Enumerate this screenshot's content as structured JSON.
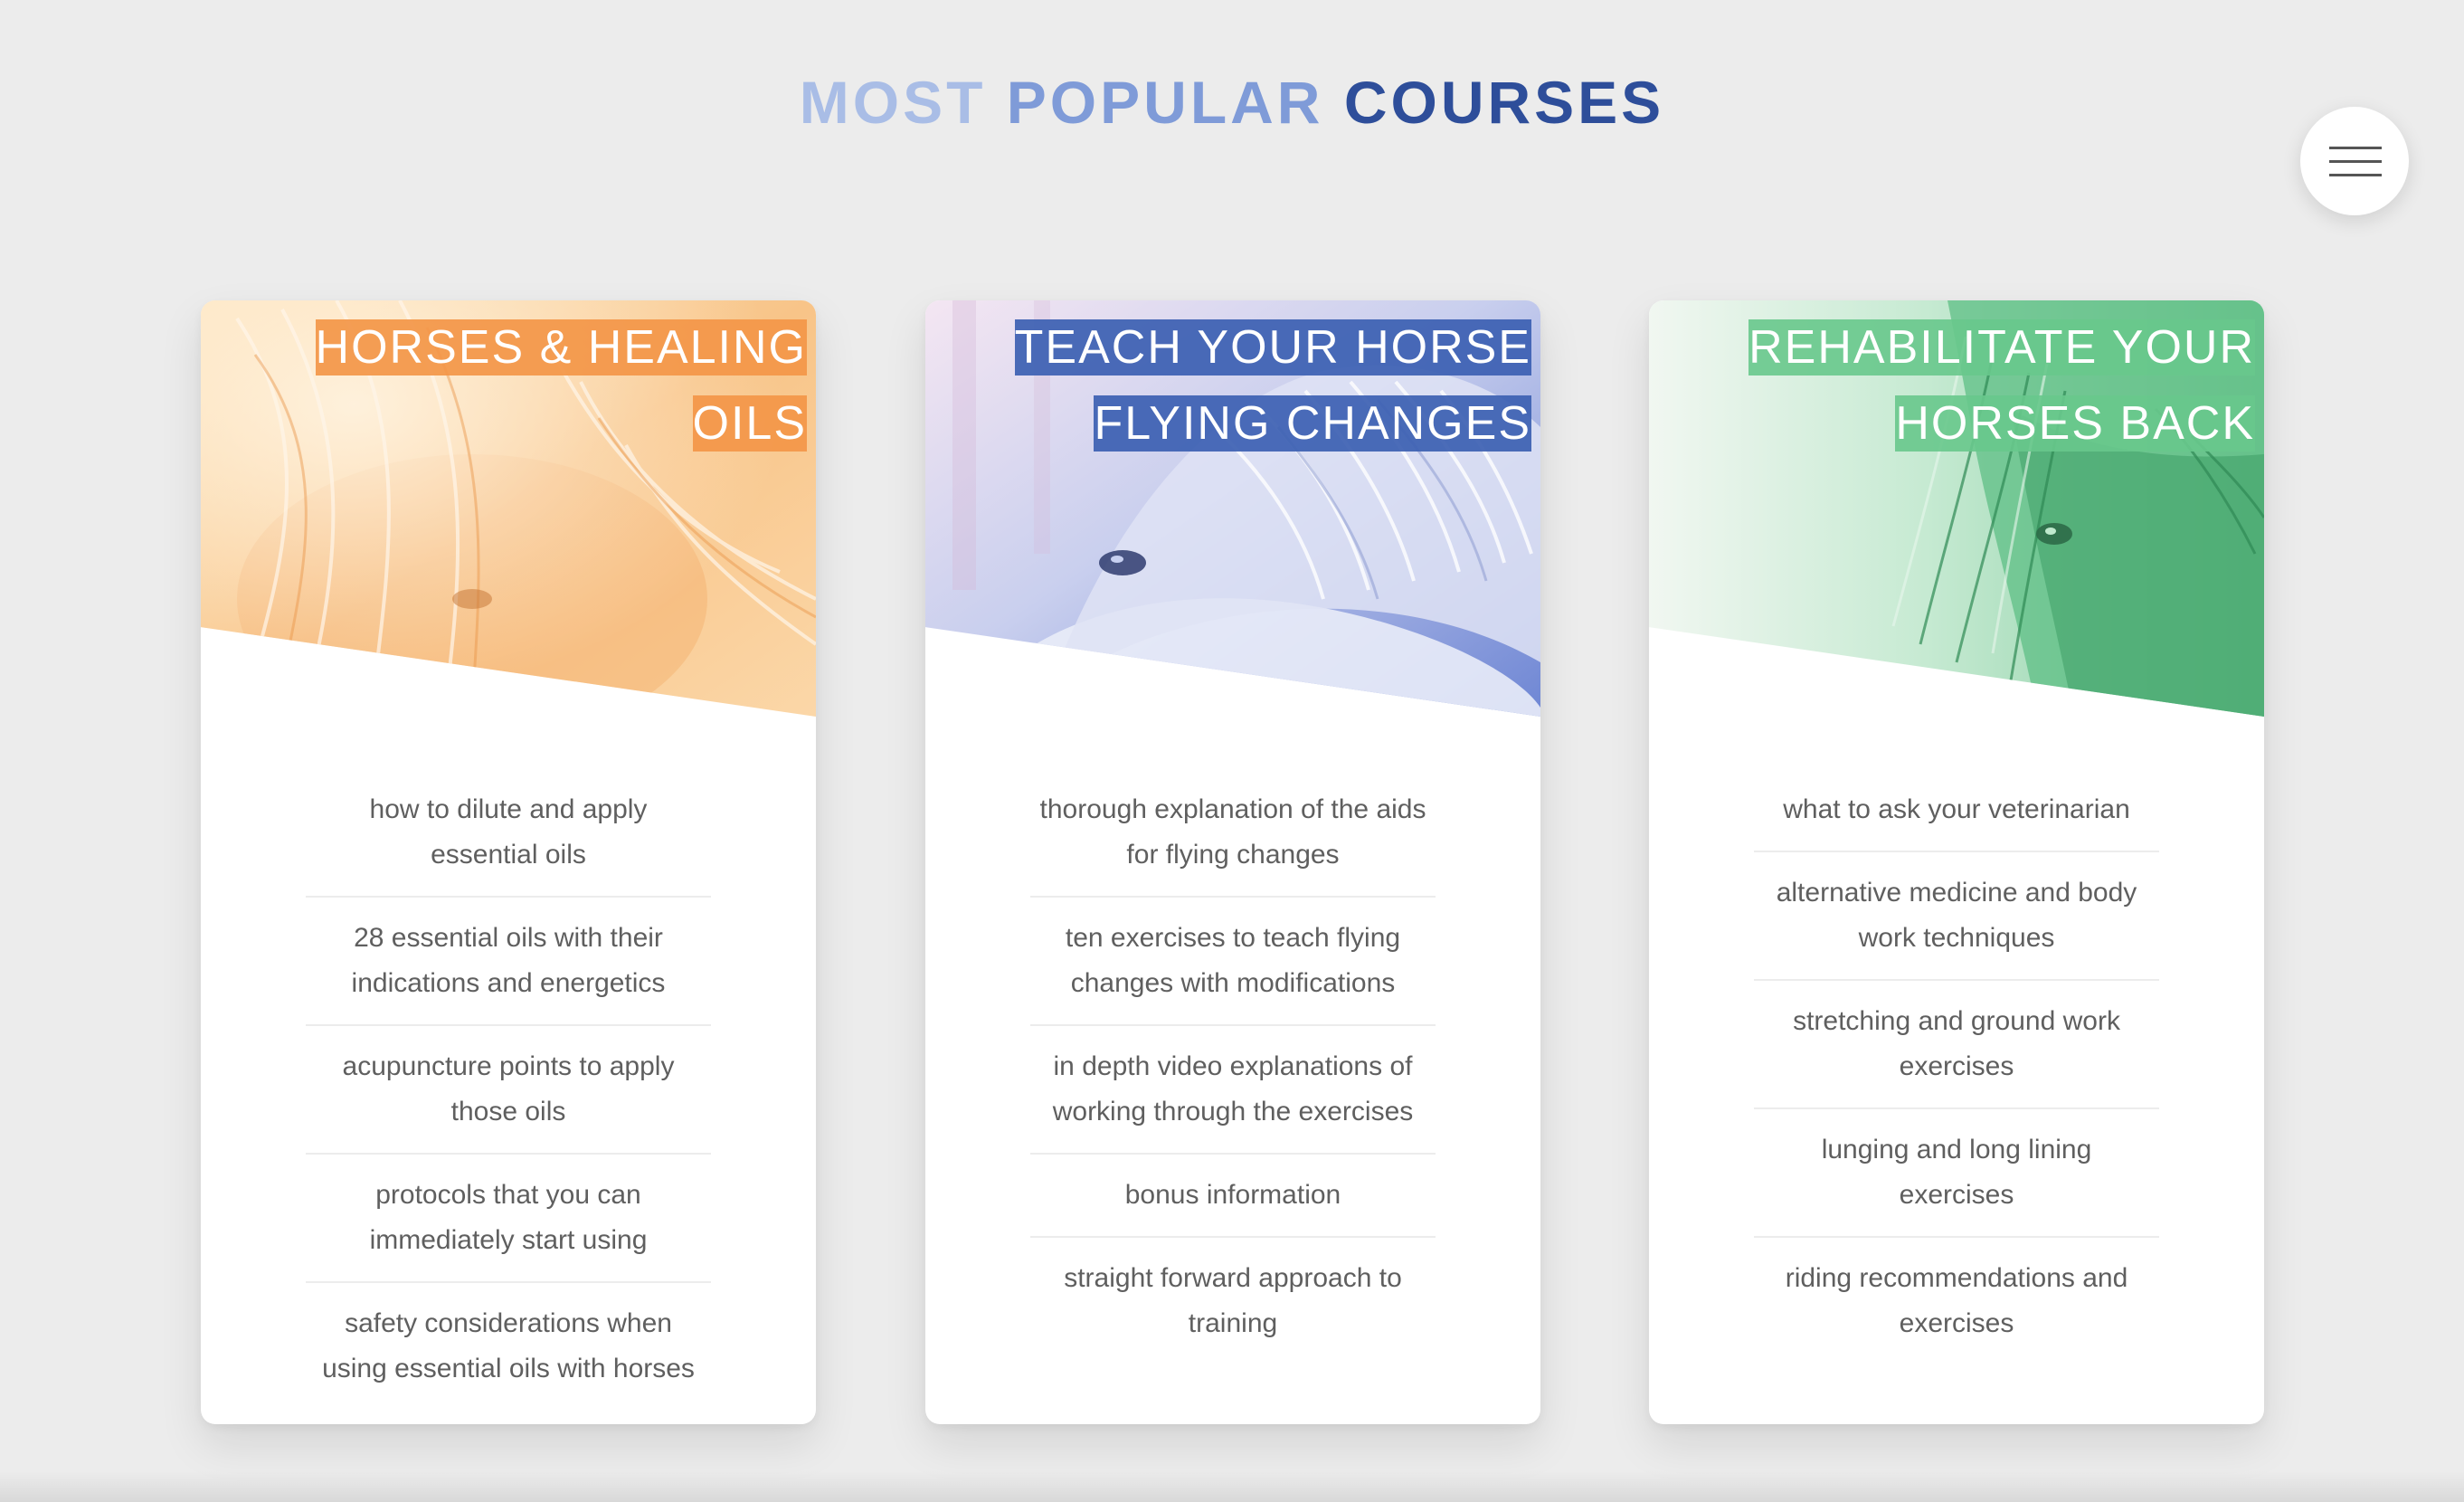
{
  "page": {
    "title_word1": "MOST",
    "title_word2": "POPULAR",
    "title_word3": "COURSES",
    "menu_icon": "hamburger-menu-icon"
  },
  "colors": {
    "title_light": "#a9bde6",
    "title_mid": "#7f9bd8",
    "title_dark": "#2e4e9a",
    "orange_accent": "#f39648",
    "blue_accent": "#3c5fb2",
    "green_accent": "#68c88c"
  },
  "courses": [
    {
      "title": "HORSES & HEALING OILS",
      "theme": "orange",
      "image": "palomino-horse-mane-photo",
      "features": [
        "how to dilute and apply essential oils",
        "28 essential oils with their indications and energetics",
        "acupuncture points to apply those oils",
        "protocols that you can immediately start using",
        "safety considerations when using essential oils with horses"
      ]
    },
    {
      "title": "TEACH YOUR HORSE FLYING CHANGES",
      "theme": "blue",
      "image": "grey-horse-eye-photo",
      "features": [
        "thorough explanation of the aids for flying changes",
        "ten exercises to teach flying changes with modifications",
        "in depth video explanations of working through the exercises",
        "bonus information",
        "straight forward approach to training"
      ]
    },
    {
      "title": "REHABILITATE YOUR HORSES BACK",
      "theme": "green",
      "image": "dark-horse-forelock-photo",
      "features": [
        "what to ask your veterinarian",
        "alternative medicine and body work techniques",
        "stretching and ground work exercises",
        "lunging and long lining exercises",
        "riding recommendations and exercises"
      ]
    }
  ]
}
